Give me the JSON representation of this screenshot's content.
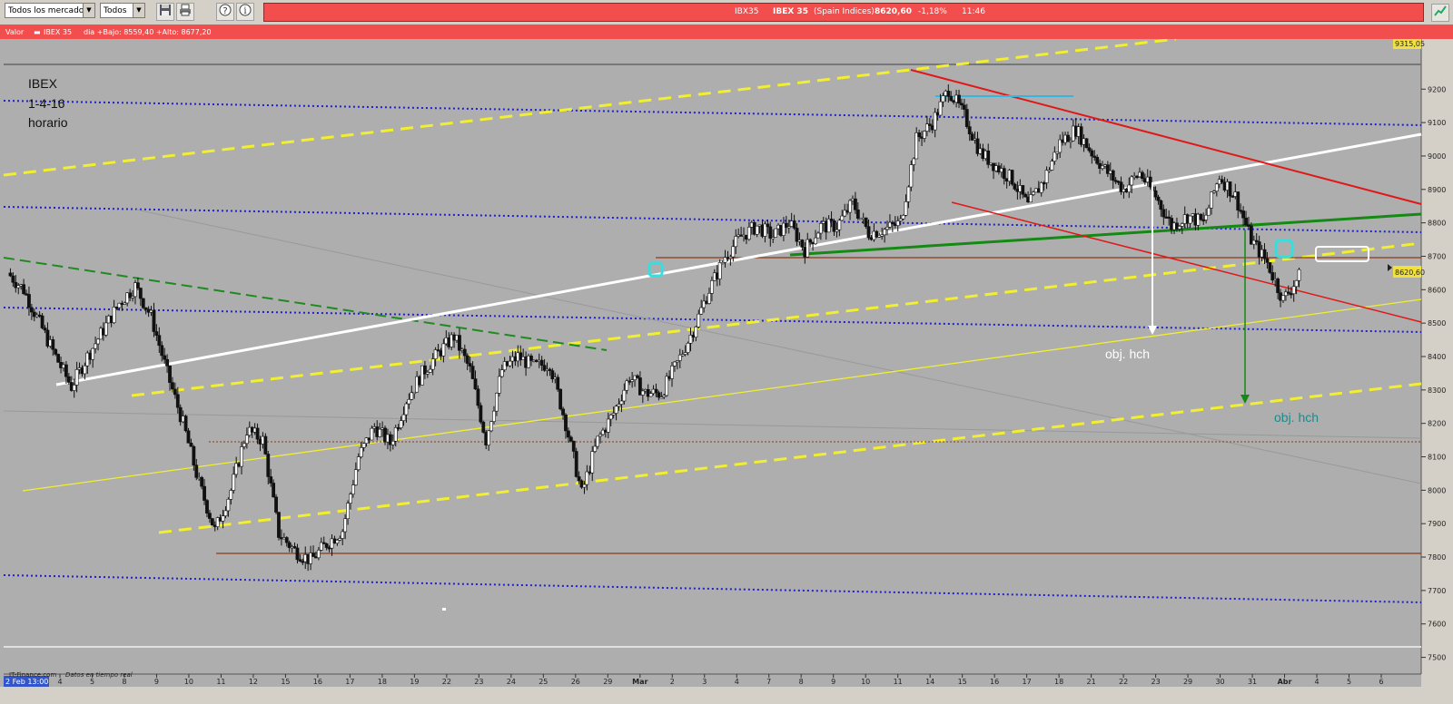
{
  "toolbar": {
    "market_select": "Todos los mercados",
    "type_select": "Todos",
    "save_icon": "save-icon",
    "print_icon": "print-icon",
    "help_icon": "help-icon",
    "info_icon": "info-icon",
    "chart_icon": "chart-icon"
  },
  "quote": {
    "symbol": "IBX35",
    "name": "IBEX 35",
    "market": "(Spain Indices)",
    "price": "8620,60",
    "change": "-1,18%",
    "time": "11:46"
  },
  "info_bar": {
    "label": "Valor",
    "series": "IBEX 35",
    "range": "dia +Bajo: 8559,40 +Alto: 8677,20"
  },
  "chart_data": {
    "type": "candlestick",
    "title": "IBEX",
    "subtitle_lines": [
      "1-4-16",
      "horario"
    ],
    "ylim": [
      7450,
      9350
    ],
    "yticks": [
      7500,
      7600,
      7700,
      7800,
      7900,
      8000,
      8100,
      8200,
      8300,
      8400,
      8500,
      8600,
      8700,
      8800,
      8900,
      9000,
      9100,
      9200
    ],
    "price_tag_top": "9315,05",
    "price_tag_current": "8620,60",
    "current_price": 8620.6,
    "x_start_label": "2 Feb 13:00",
    "xticks": [
      "4",
      "5",
      "8",
      "9",
      "10",
      "11",
      "12",
      "15",
      "16",
      "17",
      "18",
      "19",
      "22",
      "23",
      "24",
      "25",
      "26",
      "29",
      "Mar",
      "2",
      "3",
      "4",
      "7",
      "8",
      "9",
      "10",
      "11",
      "14",
      "15",
      "16",
      "17",
      "18",
      "21",
      "22",
      "23",
      "29",
      "30",
      "31",
      "Abr",
      "4",
      "5",
      "6"
    ],
    "close_path": [
      [
        0,
        8650
      ],
      [
        1,
        8600
      ],
      [
        2,
        8500
      ],
      [
        3,
        8400
      ],
      [
        4,
        8310
      ],
      [
        5,
        8400
      ],
      [
        6,
        8480
      ],
      [
        7,
        8560
      ],
      [
        8,
        8610
      ],
      [
        9,
        8520
      ],
      [
        10,
        8350
      ],
      [
        11,
        8200
      ],
      [
        12,
        8020
      ],
      [
        13,
        7880
      ],
      [
        14,
        8000
      ],
      [
        15,
        8180
      ],
      [
        16,
        8150
      ],
      [
        17,
        7870
      ],
      [
        18,
        7820
      ],
      [
        19,
        7790
      ],
      [
        20,
        7840
      ],
      [
        21,
        7880
      ],
      [
        22,
        8100
      ],
      [
        23,
        8190
      ],
      [
        24,
        8140
      ],
      [
        25,
        8270
      ],
      [
        26,
        8350
      ],
      [
        27,
        8410
      ],
      [
        28,
        8460
      ],
      [
        29,
        8360
      ],
      [
        30,
        8150
      ],
      [
        31,
        8360
      ],
      [
        32,
        8400
      ],
      [
        33,
        8370
      ],
      [
        34,
        8380
      ],
      [
        35,
        8200
      ],
      [
        36,
        7990
      ],
      [
        37,
        8150
      ],
      [
        38,
        8230
      ],
      [
        39,
        8340
      ],
      [
        40,
        8290
      ],
      [
        41,
        8290
      ],
      [
        42,
        8380
      ],
      [
        43,
        8480
      ],
      [
        44,
        8600
      ],
      [
        45,
        8700
      ],
      [
        46,
        8760
      ],
      [
        47,
        8790
      ],
      [
        48,
        8760
      ],
      [
        49,
        8800
      ],
      [
        50,
        8720
      ],
      [
        51,
        8790
      ],
      [
        52,
        8790
      ],
      [
        53,
        8860
      ],
      [
        54,
        8770
      ],
      [
        55,
        8780
      ],
      [
        56,
        8800
      ],
      [
        57,
        9050
      ],
      [
        58,
        9100
      ],
      [
        59,
        9200
      ],
      [
        60,
        9120
      ],
      [
        61,
        9010
      ],
      [
        62,
        8970
      ],
      [
        63,
        8930
      ],
      [
        64,
        8850
      ],
      [
        65,
        8930
      ],
      [
        66,
        9040
      ],
      [
        67,
        9080
      ],
      [
        68,
        9010
      ],
      [
        69,
        8950
      ],
      [
        70,
        8900
      ],
      [
        71,
        8950
      ],
      [
        72,
        8880
      ],
      [
        73,
        8790
      ],
      [
        74,
        8820
      ],
      [
        75,
        8800
      ],
      [
        76,
        8940
      ],
      [
        77,
        8880
      ],
      [
        78,
        8750
      ],
      [
        79,
        8680
      ],
      [
        80,
        8570
      ],
      [
        81,
        8640
      ]
    ],
    "annotations": [
      {
        "text": "obj. hch",
        "color": "#ffffff"
      },
      {
        "text": "obj. hch",
        "color": "#1f8a8a"
      }
    ],
    "grid": false
  },
  "footer": {
    "provider": "IT-Finance.com",
    "realtime": "Datos en tiempo real"
  }
}
